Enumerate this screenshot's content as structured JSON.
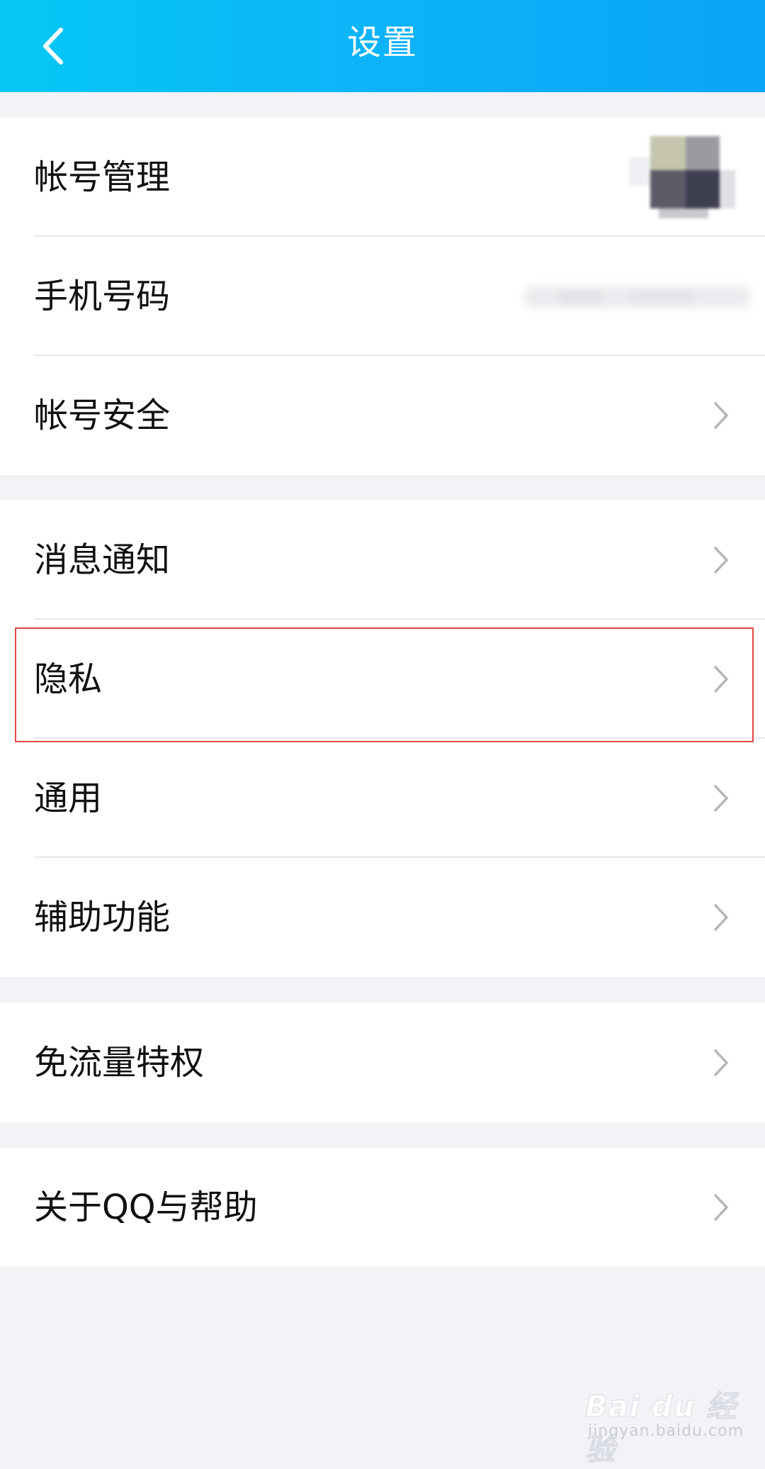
{
  "header": {
    "title": "设置",
    "back_icon": "chevron-left-icon",
    "gradient_colors": [
      "#05c8f5",
      "#0aa5f7"
    ]
  },
  "groups": [
    {
      "items": [
        {
          "label": "帐号管理",
          "trailing": "blurred-avatar"
        },
        {
          "label": "手机号码",
          "trailing": "blurred-phone"
        },
        {
          "label": "帐号安全",
          "trailing": "chevron-right-icon"
        }
      ]
    },
    {
      "items": [
        {
          "label": "消息通知",
          "trailing": "chevron-right-icon"
        },
        {
          "label": "隐私",
          "trailing": "chevron-right-icon",
          "highlighted": true
        },
        {
          "label": "通用",
          "trailing": "chevron-right-icon"
        },
        {
          "label": "辅助功能",
          "trailing": "chevron-right-icon"
        }
      ]
    },
    {
      "items": [
        {
          "label": "免流量特权",
          "trailing": "chevron-right-icon"
        }
      ]
    },
    {
      "items": [
        {
          "label": "关于QQ与帮助",
          "trailing": "chevron-right-icon"
        }
      ]
    }
  ],
  "highlight_color": "#e54646",
  "watermark": {
    "brand": "Bai du 经验",
    "url": "jingyan.baidu.com"
  }
}
